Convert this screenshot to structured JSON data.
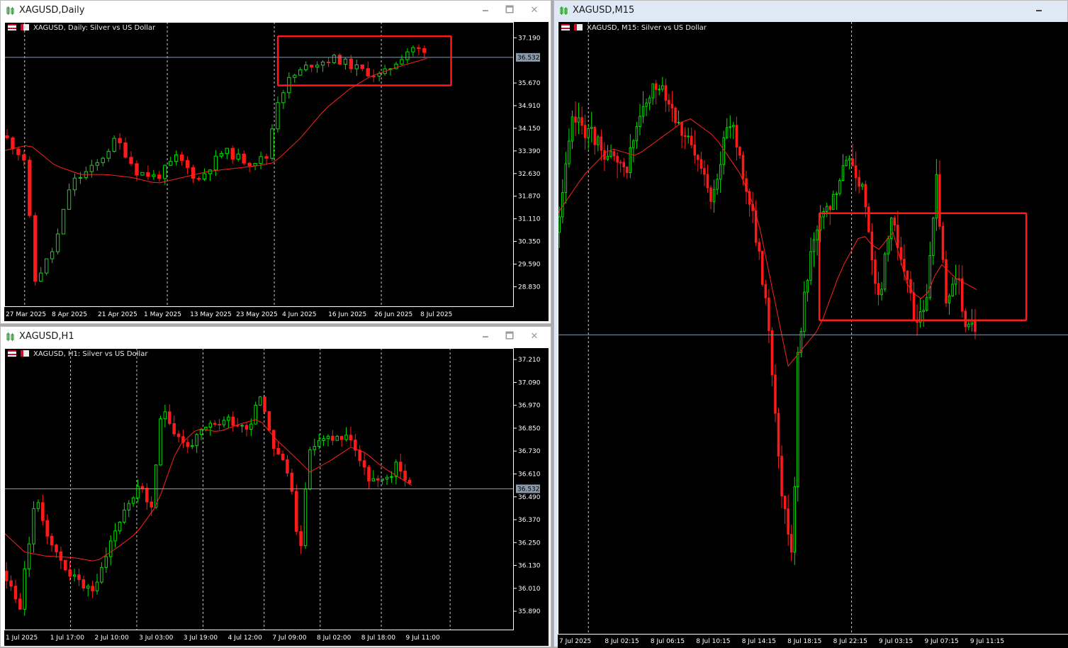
{
  "colors": {
    "bull": "#00e000",
    "bear": "#ff1a1a",
    "ma": "#ff2020",
    "grid": "#c8c8c8",
    "bidline": "#8a9aaa",
    "highlight": "#ff1a1a",
    "bg": "#000000"
  },
  "window_buttons": {
    "minimize": "🗕",
    "maximize": "🗖",
    "close": "✕"
  },
  "windows": [
    {
      "id": "daily",
      "title": "XAGUSD,Daily",
      "header": "XAGUSD, Daily:  Silver vs US Dollar",
      "bid_label": "36.532",
      "bid": 36.532,
      "y_ticks": [
        "37.190",
        "35.670",
        "34.910",
        "34.150",
        "33.390",
        "32.630",
        "31.870",
        "31.110",
        "30.350",
        "29.590",
        "28.830"
      ],
      "ylim": [
        28.15,
        37.72
      ],
      "x_labels": [
        "27 Mar 2025",
        "8 Apr 2025",
        "21 Apr 2025",
        "1 May 2025",
        "13 May 2025",
        "23 May 2025",
        "4 Jun 2025",
        "16 Jun 2025",
        "26 Jun 2025",
        "8 Jul 2025"
      ],
      "grid_positions": [
        0.04,
        0.32,
        0.53,
        0.74
      ],
      "highlight": {
        "x0": 0.537,
        "x1": 0.877,
        "y_top": 37.24,
        "y_bottom": 35.59
      },
      "trend": [
        [
          0,
          33.9
        ],
        [
          0.04,
          33.1
        ],
        [
          0.06,
          29.0
        ],
        [
          0.1,
          30.2
        ],
        [
          0.13,
          32.3
        ],
        [
          0.18,
          32.9
        ],
        [
          0.22,
          33.8
        ],
        [
          0.26,
          32.7
        ],
        [
          0.3,
          32.5
        ],
        [
          0.34,
          33.2
        ],
        [
          0.38,
          32.4
        ],
        [
          0.43,
          33.4
        ],
        [
          0.48,
          33.0
        ],
        [
          0.52,
          33.2
        ],
        [
          0.53,
          34.9
        ],
        [
          0.56,
          35.8
        ],
        [
          0.6,
          36.3
        ],
        [
          0.65,
          36.5
        ],
        [
          0.7,
          36.1
        ],
        [
          0.74,
          35.9
        ],
        [
          0.77,
          36.4
        ],
        [
          0.8,
          36.9
        ],
        [
          0.83,
          36.6
        ]
      ],
      "ma": [
        [
          0,
          33.4
        ],
        [
          0.05,
          33.6
        ],
        [
          0.1,
          32.9
        ],
        [
          0.15,
          32.6
        ],
        [
          0.2,
          32.6
        ],
        [
          0.25,
          32.5
        ],
        [
          0.3,
          32.3
        ],
        [
          0.35,
          32.5
        ],
        [
          0.4,
          32.7
        ],
        [
          0.45,
          32.8
        ],
        [
          0.5,
          32.9
        ],
        [
          0.53,
          33.0
        ],
        [
          0.58,
          33.8
        ],
        [
          0.63,
          34.8
        ],
        [
          0.68,
          35.5
        ],
        [
          0.72,
          35.9
        ],
        [
          0.77,
          36.2
        ],
        [
          0.83,
          36.5
        ]
      ],
      "n": 75,
      "seed": 11,
      "vol": 0.35
    },
    {
      "id": "h1",
      "title": "XAGUSD,H1",
      "header": "XAGUSD, H1:  Silver vs US Dollar",
      "bid_label": "36.532",
      "bid": 36.532,
      "y_ticks": [
        "37.210",
        "37.090",
        "36.970",
        "36.850",
        "36.730",
        "36.610",
        "36.490",
        "36.370",
        "36.250",
        "36.130",
        "36.010",
        "35.890"
      ],
      "ylim": [
        35.79,
        37.27
      ],
      "x_labels": [
        "1 Jul 2025",
        "1 Jul 17:00",
        "2 Jul 10:00",
        "3 Jul 03:00",
        "3 Jul 19:00",
        "4 Jul 12:00",
        "7 Jul 09:00",
        "8 Jul 02:00",
        "8 Jul 18:00",
        "9 Jul 11:00"
      ],
      "grid_positions": [
        0.13,
        0.26,
        0.39,
        0.51,
        0.62,
        0.74,
        0.875
      ],
      "trend": [
        [
          0,
          36.1
        ],
        [
          0.03,
          35.9
        ],
        [
          0.06,
          36.48
        ],
        [
          0.1,
          36.2
        ],
        [
          0.14,
          36.05
        ],
        [
          0.18,
          36.0
        ],
        [
          0.2,
          36.2
        ],
        [
          0.24,
          36.45
        ],
        [
          0.27,
          36.55
        ],
        [
          0.29,
          36.4
        ],
        [
          0.31,
          37.0
        ],
        [
          0.33,
          36.85
        ],
        [
          0.36,
          36.75
        ],
        [
          0.4,
          36.85
        ],
        [
          0.44,
          36.9
        ],
        [
          0.48,
          36.85
        ],
        [
          0.5,
          37.05
        ],
        [
          0.53,
          36.75
        ],
        [
          0.56,
          36.6
        ],
        [
          0.58,
          36.2
        ],
        [
          0.6,
          36.75
        ],
        [
          0.64,
          36.8
        ],
        [
          0.68,
          36.8
        ],
        [
          0.71,
          36.6
        ],
        [
          0.74,
          36.55
        ],
        [
          0.77,
          36.65
        ],
        [
          0.8,
          36.55
        ]
      ],
      "ma": [
        [
          0,
          36.3
        ],
        [
          0.04,
          36.2
        ],
        [
          0.08,
          36.18
        ],
        [
          0.14,
          36.17
        ],
        [
          0.18,
          36.15
        ],
        [
          0.22,
          36.22
        ],
        [
          0.26,
          36.3
        ],
        [
          0.3,
          36.45
        ],
        [
          0.34,
          36.75
        ],
        [
          0.38,
          36.85
        ],
        [
          0.42,
          36.83
        ],
        [
          0.46,
          36.87
        ],
        [
          0.5,
          36.9
        ],
        [
          0.53,
          36.8
        ],
        [
          0.57,
          36.7
        ],
        [
          0.6,
          36.62
        ],
        [
          0.64,
          36.68
        ],
        [
          0.68,
          36.75
        ],
        [
          0.71,
          36.72
        ],
        [
          0.74,
          36.65
        ],
        [
          0.77,
          36.6
        ],
        [
          0.8,
          36.55
        ]
      ],
      "n": 90,
      "seed": 23,
      "vol": 0.07
    },
    {
      "id": "m15",
      "title": "XAGUSD,M15",
      "header": "XAGUSD, M15:  Silver vs US Dollar",
      "bid": 36.532,
      "y_ticks": [],
      "ylim": [
        35.75,
        37.35
      ],
      "x_labels": [
        "7 Jul 2025",
        "8 Jul 02:15",
        "8 Jul 06:15",
        "8 Jul 10:15",
        "8 Jul 14:15",
        "8 Jul 18:15",
        "8 Jul 22:15",
        "9 Jul 03:15",
        "9 Jul 07:15",
        "9 Jul 11:15"
      ],
      "grid_positions": [
        0.06,
        0.575
      ],
      "highlight": {
        "x0": 0.512,
        "x1": 0.917,
        "y_top": 36.85,
        "y_bottom": 36.57
      },
      "trend": [
        [
          0,
          36.8
        ],
        [
          0.03,
          37.1
        ],
        [
          0.07,
          37.05
        ],
        [
          0.1,
          37.0
        ],
        [
          0.13,
          36.95
        ],
        [
          0.16,
          37.1
        ],
        [
          0.2,
          37.2
        ],
        [
          0.25,
          37.05
        ],
        [
          0.3,
          36.9
        ],
        [
          0.34,
          37.1
        ],
        [
          0.38,
          36.85
        ],
        [
          0.41,
          36.6
        ],
        [
          0.44,
          36.1
        ],
        [
          0.46,
          35.95
        ],
        [
          0.47,
          36.5
        ],
        [
          0.5,
          36.8
        ],
        [
          0.53,
          36.85
        ],
        [
          0.57,
          37.0
        ],
        [
          0.6,
          36.9
        ],
        [
          0.63,
          36.6
        ],
        [
          0.65,
          36.85
        ],
        [
          0.68,
          36.7
        ],
        [
          0.7,
          36.55
        ],
        [
          0.72,
          36.6
        ],
        [
          0.74,
          36.95
        ],
        [
          0.76,
          36.6
        ],
        [
          0.78,
          36.7
        ],
        [
          0.8,
          36.55
        ]
      ],
      "ma": [
        [
          0,
          36.85
        ],
        [
          0.05,
          36.95
        ],
        [
          0.1,
          37.02
        ],
        [
          0.15,
          37.0
        ],
        [
          0.2,
          37.05
        ],
        [
          0.25,
          37.1
        ],
        [
          0.3,
          37.05
        ],
        [
          0.35,
          36.95
        ],
        [
          0.38,
          36.85
        ],
        [
          0.41,
          36.65
        ],
        [
          0.44,
          36.45
        ],
        [
          0.47,
          36.5
        ],
        [
          0.5,
          36.55
        ],
        [
          0.54,
          36.7
        ],
        [
          0.58,
          36.8
        ],
        [
          0.61,
          36.75
        ],
        [
          0.64,
          36.8
        ],
        [
          0.67,
          36.65
        ],
        [
          0.7,
          36.62
        ],
        [
          0.73,
          36.72
        ],
        [
          0.76,
          36.68
        ],
        [
          0.8,
          36.65
        ]
      ],
      "n": 130,
      "seed": 37,
      "vol": 0.06
    }
  ]
}
